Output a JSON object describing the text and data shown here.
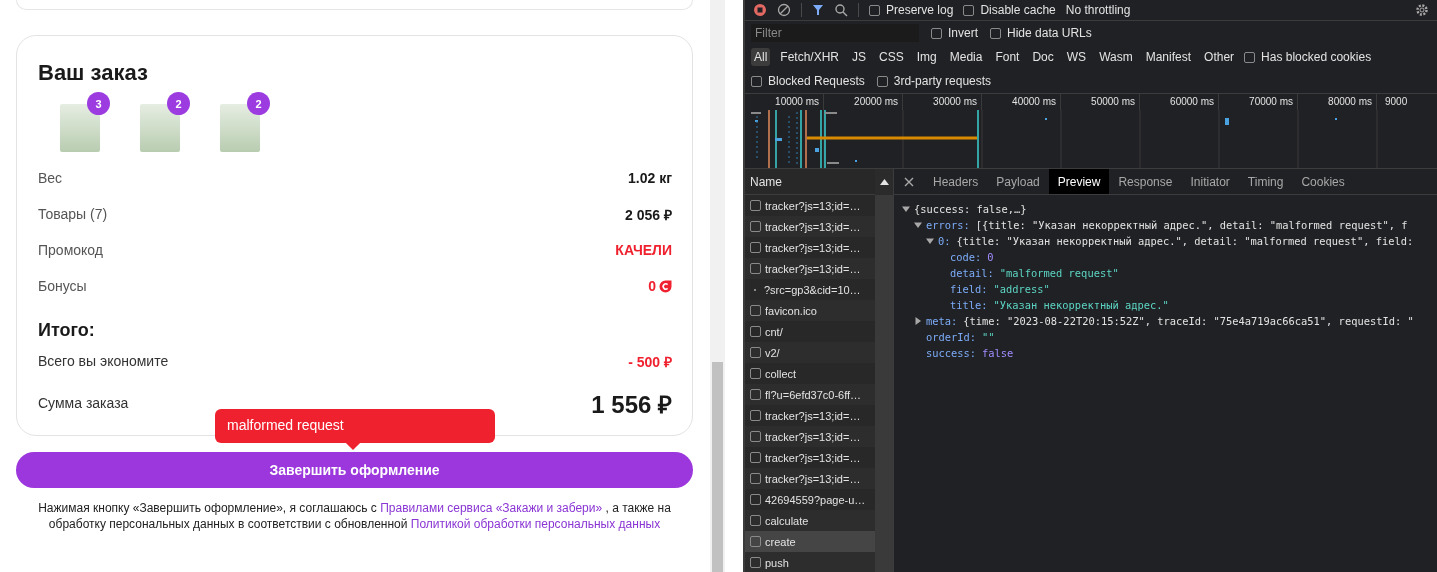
{
  "page": {
    "order": {
      "title": "Ваш заказ",
      "products": [
        {
          "count": "3"
        },
        {
          "count": "2"
        },
        {
          "count": "2"
        }
      ],
      "rows": [
        {
          "kind": "plain",
          "label": "Вес",
          "value": "1.02 кг",
          "highlight": false
        },
        {
          "kind": "plain",
          "label": "Товары (7)",
          "value": "2 056 ₽",
          "highlight": false
        },
        {
          "kind": "plain",
          "label": "Промокод",
          "value": "КАЧЕЛИ",
          "highlight": true
        },
        {
          "kind": "bonus",
          "label": "Бонусы",
          "value": "0",
          "highlight": true
        }
      ],
      "total_title": "Итого:",
      "totals": [
        {
          "kind": "saving",
          "label": "Всего вы экономите",
          "value": "- 500 ₽"
        },
        {
          "kind": "sum",
          "label": "Сумма заказа",
          "value": "1 556 ₽"
        }
      ]
    },
    "error_tooltip": "malformed request",
    "submit_button": "Завершить оформление",
    "consent": [
      {
        "kind": "text",
        "text": "Нажимая кнопку «Завершить оформление», я соглашаюсь с "
      },
      {
        "kind": "link",
        "text": "Правилами сервиса «Закажи и забери»"
      },
      {
        "kind": "text",
        "text": " , а также на обработку персональных данных в соответствии с обновленной "
      },
      {
        "kind": "link",
        "text": "Политикой обработки персональных данных"
      }
    ]
  },
  "devtools": {
    "toolbar": {
      "checkboxes": [
        {
          "label": "Preserve log",
          "checked": false
        },
        {
          "label": "Disable cache",
          "checked": false
        }
      ],
      "throttling": "No throttling"
    },
    "filter": {
      "placeholder": "Filter",
      "options": [
        {
          "label": "Invert",
          "checked": false
        },
        {
          "label": "Hide data URLs",
          "checked": false
        }
      ]
    },
    "types": [
      {
        "label": "All",
        "selected": true
      },
      {
        "label": "Fetch/XHR",
        "selected": false
      },
      {
        "label": "JS",
        "selected": false
      },
      {
        "label": "CSS",
        "selected": false
      },
      {
        "label": "Img",
        "selected": false
      },
      {
        "label": "Media",
        "selected": false
      },
      {
        "label": "Font",
        "selected": false
      },
      {
        "label": "Doc",
        "selected": false
      },
      {
        "label": "WS",
        "selected": false
      },
      {
        "label": "Wasm",
        "selected": false
      },
      {
        "label": "Manifest",
        "selected": false
      },
      {
        "label": "Other",
        "selected": false
      }
    ],
    "has_blocked_cookies": {
      "label": "Has blocked cookies",
      "checked": false
    },
    "extra_options": [
      {
        "label": "Blocked Requests",
        "checked": false
      },
      {
        "label": "3rd-party requests",
        "checked": false
      }
    ],
    "timeline": {
      "ticks": [
        "10000 ms",
        "20000 ms",
        "30000 ms",
        "40000 ms",
        "50000 ms",
        "60000 ms",
        "70000 ms",
        "80000 ms",
        "9000"
      ]
    },
    "requests": {
      "column": "Name",
      "rows": [
        {
          "kind": "checkbox",
          "name": "tracker?js=13;id=…",
          "selected": false
        },
        {
          "kind": "checkbox",
          "name": "tracker?js=13;id=…",
          "selected": false
        },
        {
          "kind": "checkbox",
          "name": "tracker?js=13;id=…",
          "selected": false
        },
        {
          "kind": "checkbox",
          "name": "tracker?js=13;id=…",
          "selected": false
        },
        {
          "kind": "dot",
          "name": "?src=gp3&cid=10…",
          "selected": false
        },
        {
          "kind": "checkbox",
          "name": "favicon.ico",
          "selected": false
        },
        {
          "kind": "checkbox",
          "name": "cnt/",
          "selected": false
        },
        {
          "kind": "checkbox",
          "name": "v2/",
          "selected": false
        },
        {
          "kind": "checkbox",
          "name": "collect",
          "selected": false
        },
        {
          "kind": "checkbox",
          "name": "fl?u=6efd37c0-6ff…",
          "selected": false
        },
        {
          "kind": "checkbox",
          "name": "tracker?js=13;id=…",
          "selected": false
        },
        {
          "kind": "checkbox",
          "name": "tracker?js=13;id=…",
          "selected": false
        },
        {
          "kind": "checkbox",
          "name": "tracker?js=13;id=…",
          "selected": false
        },
        {
          "kind": "checkbox",
          "name": "tracker?js=13;id=…",
          "selected": false
        },
        {
          "kind": "checkbox",
          "name": "42694559?page-u…",
          "selected": false
        },
        {
          "kind": "checkbox",
          "name": "calculate",
          "selected": false
        },
        {
          "kind": "checkbox",
          "name": "create",
          "selected": true
        },
        {
          "kind": "checkbox",
          "name": "push",
          "selected": false
        }
      ]
    },
    "detail": {
      "tabs": [
        {
          "label": "Headers",
          "selected": false
        },
        {
          "label": "Payload",
          "selected": false
        },
        {
          "label": "Preview",
          "selected": true
        },
        {
          "label": "Response",
          "selected": false
        },
        {
          "label": "Initiator",
          "selected": false
        },
        {
          "label": "Timing",
          "selected": false
        },
        {
          "label": "Cookies",
          "selected": false
        }
      ],
      "preview": {
        "value": "{success: false,…}",
        "kind": "object",
        "expanded": true,
        "children": [
          {
            "key": "errors:",
            "value": "[{title: \"Указан некорректный адрес.\", detail: \"malformed request\", f",
            "kind": "object",
            "expanded": true,
            "children": [
              {
                "key": "0:",
                "value": "{title: \"Указан некорректный адрес.\", detail: \"malformed request\", field:",
                "kind": "object",
                "expanded": true,
                "children": [
                  {
                    "key": "code:",
                    "value": "0",
                    "kind": "number"
                  },
                  {
                    "key": "detail:",
                    "value": "\"malformed request\"",
                    "kind": "string"
                  },
                  {
                    "key": "field:",
                    "value": "\"address\"",
                    "kind": "string"
                  },
                  {
                    "key": "title:",
                    "value": "\"Указан некорректный адрес.\"",
                    "kind": "string"
                  }
                ]
              }
            ]
          },
          {
            "key": "meta:",
            "value": "{time: \"2023-08-22T20:15:52Z\", traceId: \"75e4a719ac66ca51\", requestId: \"",
            "kind": "object",
            "expanded": false
          },
          {
            "key": "orderId:",
            "value": "\"\"",
            "kind": "string"
          },
          {
            "key": "success:",
            "value": "false",
            "kind": "boolean"
          }
        ]
      }
    }
  }
}
